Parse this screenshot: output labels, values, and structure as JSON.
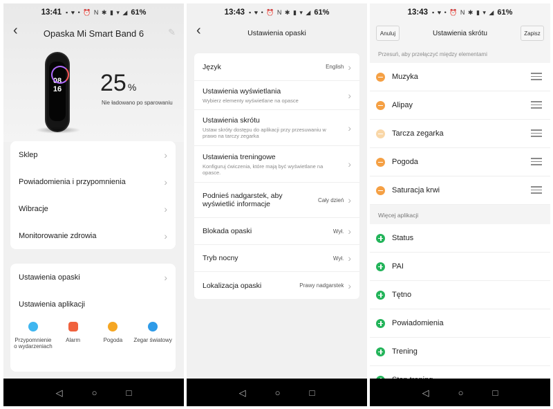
{
  "status_bars": [
    {
      "time": "13:41",
      "icons": "▪ ♥ • ⏰ N ✱ ▮ ▾ ◢",
      "battery": "61%"
    },
    {
      "time": "13:43",
      "icons": "▪ ♥ • ⏰ N ✱ ▮ ▾ ◢",
      "battery": "61%"
    },
    {
      "time": "13:43",
      "icons": "▪ ♥ • ⏰ N ✱ ▮ ▾ ◢",
      "battery": "61%"
    }
  ],
  "screen1": {
    "title": "Opaska Mi Smart Band 6",
    "band_time": [
      "08",
      "16"
    ],
    "battery_value": "25",
    "battery_unit": "%",
    "battery_label": "Nie ładowano po sparowaniu",
    "menu": [
      "Sklep",
      "Powiadomienia i przypomnienia",
      "Wibracje",
      "Monitorowanie zdrowia"
    ],
    "settings": [
      "Ustawienia opaski",
      "Ustawienia aplikacji"
    ],
    "apps": [
      {
        "label": "Przypomnienie o wydarzeniach",
        "icon": "event-reminder-icon",
        "color": "#3fb6f0"
      },
      {
        "label": "Alarm",
        "icon": "alarm-icon",
        "color": "#f0623e"
      },
      {
        "label": "Pogoda",
        "icon": "weather-icon",
        "color": "#f5a623"
      },
      {
        "label": "Zegar światowy",
        "icon": "world-clock-icon",
        "color": "#2e9be8"
      }
    ]
  },
  "screen2": {
    "title": "Ustawienia opaski",
    "rows": [
      {
        "title": "Język",
        "subtitle": "",
        "value": "English"
      },
      {
        "title": "Ustawienia wyświetlania",
        "subtitle": "Wybierz elementy wyświetlane na opasce",
        "value": ""
      },
      {
        "title": "Ustawienia skrótu",
        "subtitle": "Ustaw skróty dostępu do aplikacji przy przesuwaniu w prawo na tarczy zegarka",
        "value": ""
      },
      {
        "title": "Ustawienia treningowe",
        "subtitle": "Konfiguruj ćwiczenia, które mają być wyświetlane na opasce.",
        "value": ""
      },
      {
        "title": "Podnieś nadgarstek, aby wyświetlić informacje",
        "subtitle": "",
        "value": "Cały dzień"
      },
      {
        "title": "Blokada opaski",
        "subtitle": "",
        "value": "Wył."
      },
      {
        "title": "Tryb nocny",
        "subtitle": "",
        "value": "Wył."
      },
      {
        "title": "Lokalizacja opaski",
        "subtitle": "",
        "value": "Prawy nadgarstek"
      }
    ]
  },
  "screen3": {
    "title": "Ustawienia skrótu",
    "cancel": "Anuluj",
    "save": "Zapisz",
    "hint": "Przesuń, aby przełączyć między elementami",
    "active": [
      "Muzyka",
      "Alipay",
      "Tarcza zegarka",
      "Pogoda",
      "Saturacja krwi"
    ],
    "more_header": "Więcej aplikacji",
    "more": [
      "Status",
      "PAI",
      "Tętno",
      "Powiadomienia",
      "Trening",
      "Stop trening"
    ]
  },
  "colors": {
    "minus": "#f5a044",
    "minus_disabled": "#f9d7a8",
    "plus": "#23b45a"
  }
}
